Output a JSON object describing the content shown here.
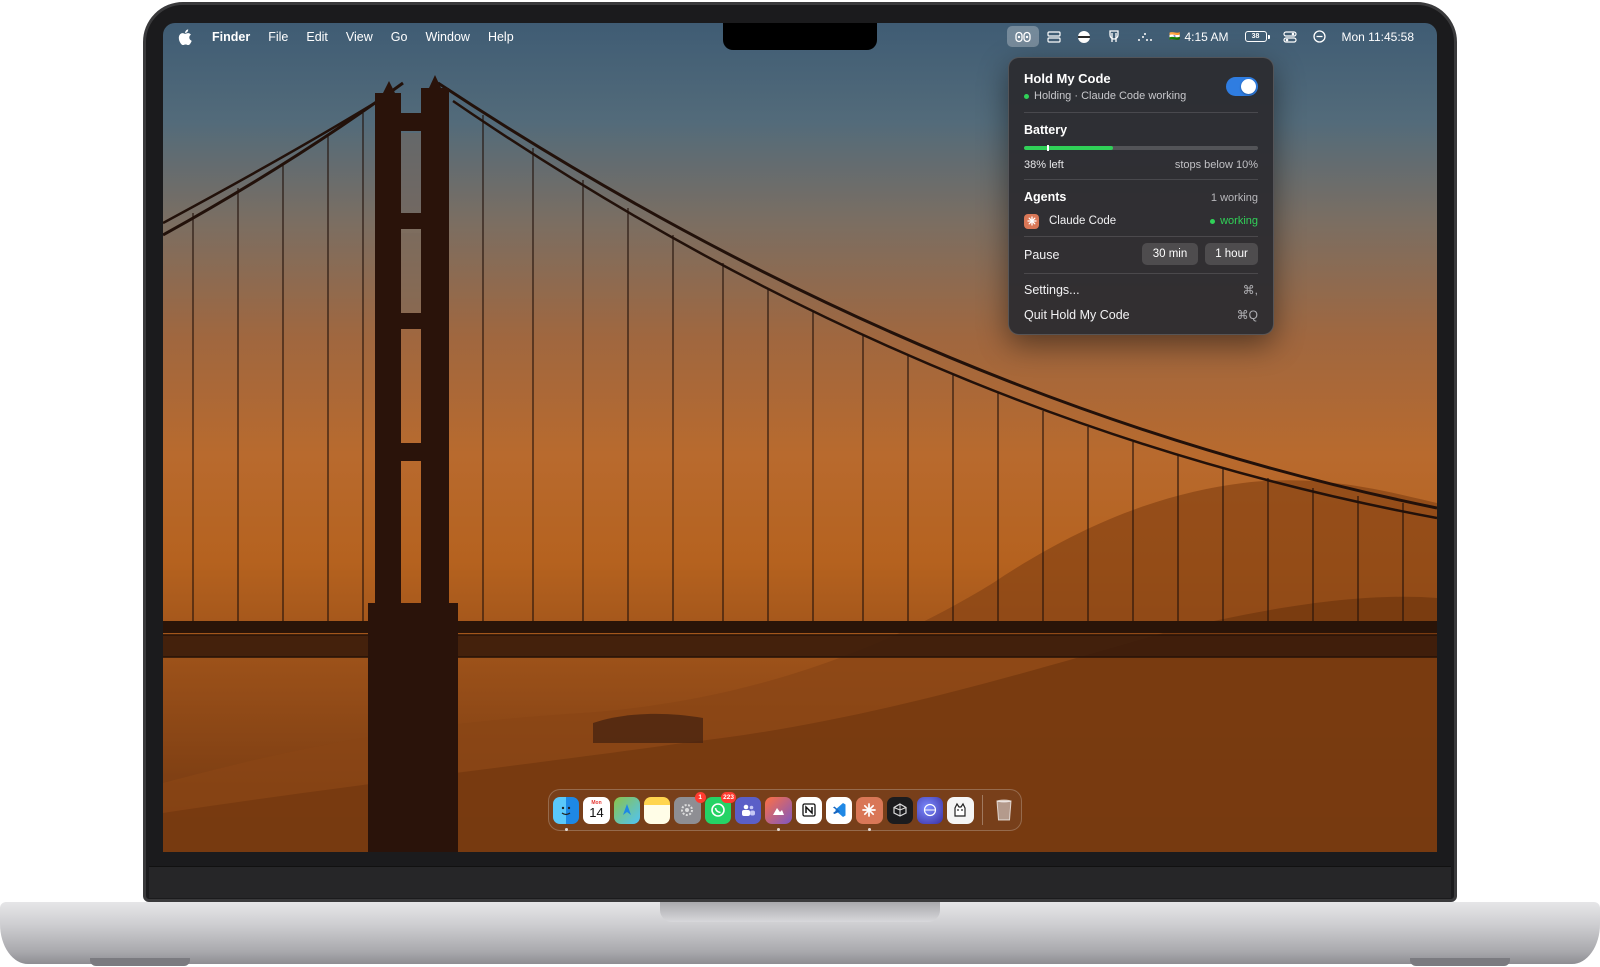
{
  "menubar": {
    "apple_icon": "apple-logo-icon",
    "app_name": "Finder",
    "menus": [
      "File",
      "Edit",
      "View",
      "Go",
      "Window",
      "Help"
    ],
    "status_icons": [
      "hold-my-code-icon",
      "storage-icon",
      "vpn-globe-icon",
      "trophy-icon",
      "wifi-dots-icon"
    ],
    "clock_flag": "🇮🇳",
    "world_clock": "4:15 AM",
    "battery_percent": "38",
    "date_time": "Mon 11:45:58"
  },
  "popover": {
    "title": "Hold My Code",
    "subtitle": "Holding · Claude Code working",
    "toggle_on": true,
    "battery": {
      "title": "Battery",
      "level": 0.38,
      "threshold": 0.1,
      "left_text": "38% left",
      "right_text": "stops below 10%"
    },
    "agents": {
      "title": "Agents",
      "count_text": "1 working",
      "items": [
        {
          "name": "Claude Code",
          "status": "working"
        }
      ]
    },
    "pause": {
      "label": "Pause",
      "options": [
        "30 min",
        "1 hour"
      ]
    },
    "menu": [
      {
        "label": "Settings...",
        "shortcut": "⌘,"
      },
      {
        "label": "Quit Hold My Code",
        "shortcut": "⌘Q"
      }
    ]
  },
  "dock": {
    "calendar_month": "Mon",
    "calendar_day": "14",
    "badges": {
      "settings": "1",
      "whatsapp": "223"
    },
    "apps": [
      "finder",
      "calendar",
      "maps",
      "notes",
      "system-settings",
      "whatsapp",
      "teams",
      "photos-app",
      "notion",
      "vscode",
      "claude",
      "cursor",
      "browser",
      "pets",
      "trash"
    ]
  },
  "colors": {
    "accent_blue": "#2f7de1",
    "status_green": "#30d158",
    "claude_orange": "#d97757"
  }
}
